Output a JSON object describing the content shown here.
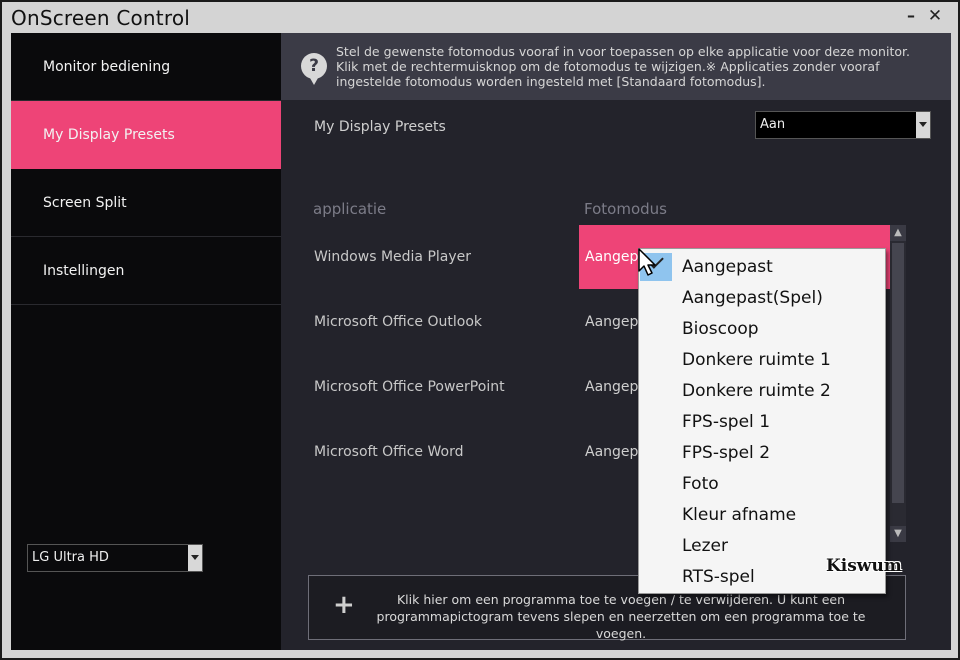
{
  "window": {
    "title": "OnScreen Control",
    "minimize_symbol": "–",
    "close_symbol": "✕"
  },
  "sidebar": {
    "items": [
      {
        "label": "Monitor bediening",
        "active": false
      },
      {
        "label": "My Display Presets",
        "active": true
      },
      {
        "label": "Screen Split",
        "active": false
      },
      {
        "label": "Instellingen",
        "active": false
      }
    ],
    "monitor_select": {
      "value": "LG Ultra HD"
    }
  },
  "info": {
    "icon": "help-icon",
    "text": "Stel de gewenste fotomodus vooraf in voor toepassen op elke applicatie voor deze monitor. Klik met de rechtermuisknop om de fotomodus te wijzigen.※ Applicaties zonder vooraf ingestelde fotomodus worden ingesteld met [Standaard fotomodus]."
  },
  "presets": {
    "label": "My Display Presets",
    "select_value": "Aan"
  },
  "table": {
    "headers": {
      "app": "applicatie",
      "mode": "Fotomodus"
    },
    "rows": [
      {
        "app": "Windows Media Player",
        "mode": "Aangepast"
      },
      {
        "app": "Microsoft Office Outlook",
        "mode": "Aangepast"
      },
      {
        "app": "Microsoft Office PowerPoint",
        "mode": "Aangepast"
      },
      {
        "app": "Microsoft Office Word",
        "mode": "Aangepast"
      }
    ],
    "visible_mode_fragment": "Aangepa"
  },
  "add_box": {
    "icon": "plus-icon",
    "text": "Klik hier om een programma toe te voegen / te verwijderen.  U kunt een programmapictogram tevens slepen en neerzetten om een programma toe te voegen."
  },
  "dropdown": {
    "selected": "Aangepast",
    "options": [
      "Aangepast",
      "Aangepast(Spel)",
      "Bioscoop",
      "Donkere ruimte 1",
      "Donkere ruimte 2",
      "FPS-spel 1",
      "FPS-spel 2",
      "Foto",
      "Kleur afname",
      "Lezer",
      "RTS-spel"
    ]
  },
  "watermark": "Kiswum",
  "colors": {
    "accent": "#ee4477",
    "sidebar_bg": "#0a0a0c",
    "panel_bg": "#23232b",
    "info_bg": "#3b3b46",
    "dropdown_bg": "#f5f5f5",
    "check_bg": "#8fc4ee"
  }
}
